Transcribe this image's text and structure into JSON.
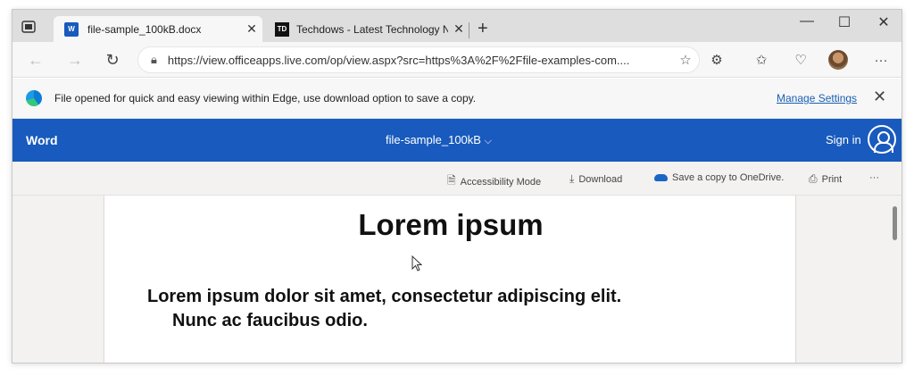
{
  "tabs": [
    {
      "title": "file-sample_100kB.docx",
      "icon": "word-icon",
      "active": true
    },
    {
      "title": "Techdows - Latest Technology N",
      "icon": "techdows-icon",
      "badge": "TD",
      "active": false
    }
  ],
  "address": {
    "url": "https://view.officeapps.live.com/op/view.aspx?src=https%3A%2F%2Ffile-examples-com...."
  },
  "infobar": {
    "message": "File opened for quick and easy viewing within Edge, use download option to save a copy.",
    "manage_label": "Manage Settings"
  },
  "word": {
    "app_name": "Word",
    "doc_name": "file-sample_100kB",
    "doc_chevron": "⌵",
    "sign_in": "Sign in"
  },
  "toolbar": {
    "accessibility": "Accessibility Mode",
    "download": "Download",
    "save_onedrive": "Save a copy to OneDrive.",
    "print": "Print",
    "more": "···"
  },
  "document": {
    "heading": "Lorem ipsum",
    "subheading_line1": "Lorem ipsum dolor sit amet, consectetur adipiscing elit.",
    "subheading_line2": "Nunc ac faucibus odio."
  },
  "colors": {
    "word_blue": "#185abd",
    "link_blue": "#1a5fb4"
  }
}
